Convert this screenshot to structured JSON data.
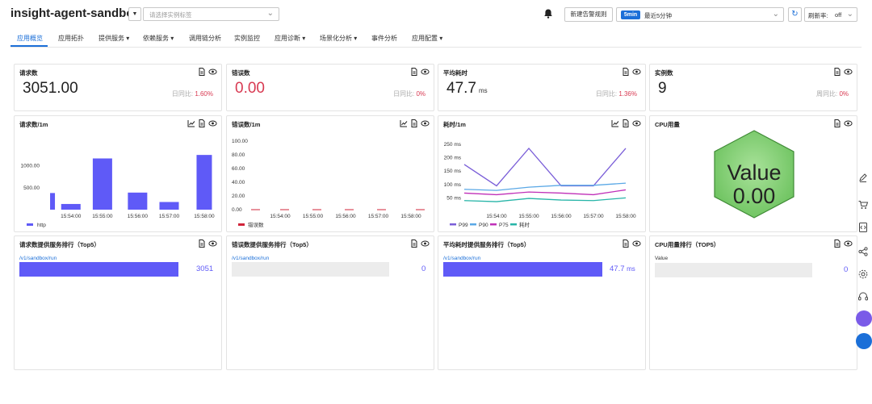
{
  "header": {
    "app_title": "insight-agent-sandbox",
    "instance_tag_placeholder": "请选择实例标签",
    "new_alert_rule_label": "新建告警规则",
    "time_badge": "5min",
    "time_range": "最近5分钟",
    "refresh_label": "刷新率:",
    "refresh_value": "off"
  },
  "tabs": [
    {
      "label": "应用概览",
      "active": true
    },
    {
      "label": "应用拓扑"
    },
    {
      "label": "提供服务 ▾"
    },
    {
      "label": "依赖服务 ▾"
    },
    {
      "label": "调用链分析"
    },
    {
      "label": "实例监控"
    },
    {
      "label": "应用诊断 ▾"
    },
    {
      "label": "场景化分析 ▾"
    },
    {
      "label": "事件分析"
    },
    {
      "label": "应用配置 ▾"
    }
  ],
  "kpis": {
    "requests": {
      "title": "请求数",
      "value": "3051.00",
      "compare_label": "日同比:",
      "compare_value": "1.60%"
    },
    "errors": {
      "title": "错误数",
      "value": "0.00",
      "compare_label": "日同比:",
      "compare_value": "0%"
    },
    "latency": {
      "title": "平均耗时",
      "value": "47.7",
      "unit": "ms",
      "compare_label": "日同比:",
      "compare_value": "1.36%"
    },
    "instances": {
      "title": "实例数",
      "value": "9",
      "compare_label": "周同比:",
      "compare_value": "0%"
    }
  },
  "charts": {
    "requests_title": "请求数/1m",
    "errors_title": "错误数/1m",
    "latency_title": "耗时/1m",
    "cpu_title": "CPU用量",
    "cpu_value_text": "Value",
    "cpu_value_number": "0.00"
  },
  "chart_data": [
    {
      "type": "bar",
      "title": "请求数/1m",
      "x_ticks": [
        "15:54:00",
        "15:55:00",
        "15:56:00",
        "15:57:00",
        "15:58:00"
      ],
      "y_ticks": [
        "500.00",
        "1000.00"
      ],
      "ylim": [
        0,
        1400
      ],
      "series": [
        {
          "name": "http",
          "color": "#5f5af7"
        }
      ],
      "bars": [
        {
          "x": 0.0,
          "value": 380
        },
        {
          "x": 0.5,
          "value": 130
        },
        {
          "x": 1.4,
          "value": 1170
        },
        {
          "x": 2.4,
          "value": 390
        },
        {
          "x": 3.3,
          "value": 175
        },
        {
          "x": 4.3,
          "value": 1250
        }
      ]
    },
    {
      "type": "line",
      "title": "错误数/1m",
      "x_ticks": [
        "15:54:00",
        "15:55:00",
        "15:56:00",
        "15:57:00",
        "15:58:00"
      ],
      "y_ticks": [
        "0.00",
        "20.00",
        "40.00",
        "60.00",
        "80.00",
        "100.00"
      ],
      "ylim": [
        0,
        100
      ],
      "series": [
        {
          "name": "错误数",
          "color": "#d0243a",
          "values": [
            0,
            0,
            0,
            0,
            0,
            0
          ]
        }
      ]
    },
    {
      "type": "line",
      "title": "耗时/1m",
      "x_ticks": [
        "15:54:00",
        "15:55:00",
        "15:56:00",
        "15:57:00",
        "15:58:00"
      ],
      "y_ticks": [
        "50 ms",
        "100 ms",
        "150 ms",
        "200 ms",
        "250 ms"
      ],
      "ylim": [
        0,
        250
      ],
      "series": [
        {
          "name": "P99",
          "color": "#7a5ed8",
          "values": [
            175,
            95,
            235,
            95,
            95,
            235
          ]
        },
        {
          "name": "P90",
          "color": "#5aa8e6",
          "values": [
            82,
            78,
            90,
            97,
            97,
            105
          ]
        },
        {
          "name": "P75",
          "color": "#c030b8",
          "values": [
            68,
            62,
            72,
            68,
            62,
            80
          ]
        },
        {
          "name": "耗时",
          "color": "#27b5a8",
          "values": [
            40,
            36,
            48,
            42,
            40,
            50
          ]
        }
      ]
    }
  ],
  "rankings": {
    "requests": {
      "title": "请求数提供服务排行（Top5）",
      "service": "/v1/sandbox/run",
      "value": "3051"
    },
    "errors": {
      "title": "错误数提供服务排行（Top5）",
      "service": "/v1/sandbox/run",
      "value": "0"
    },
    "latency": {
      "title": "平均耗时提供服务排行（Top5）",
      "service": "/v1/sandbox/run",
      "value": "47.7",
      "unit": "ms"
    },
    "cpu": {
      "title": "CPU用量排行（TOP5）",
      "service": "Value",
      "value": "0"
    }
  }
}
